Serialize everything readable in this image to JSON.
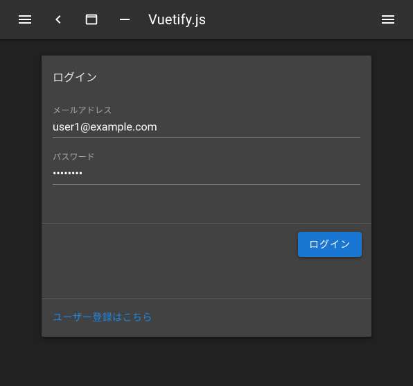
{
  "appbar": {
    "title": "Vuetify.js"
  },
  "login": {
    "card_title": "ログイン",
    "email_label": "メールアドレス",
    "email_value": "user1@example.com",
    "password_label": "パスワード",
    "password_value": "password",
    "submit_label": "ログイン",
    "register_link": "ユーザー登録はこちら"
  }
}
